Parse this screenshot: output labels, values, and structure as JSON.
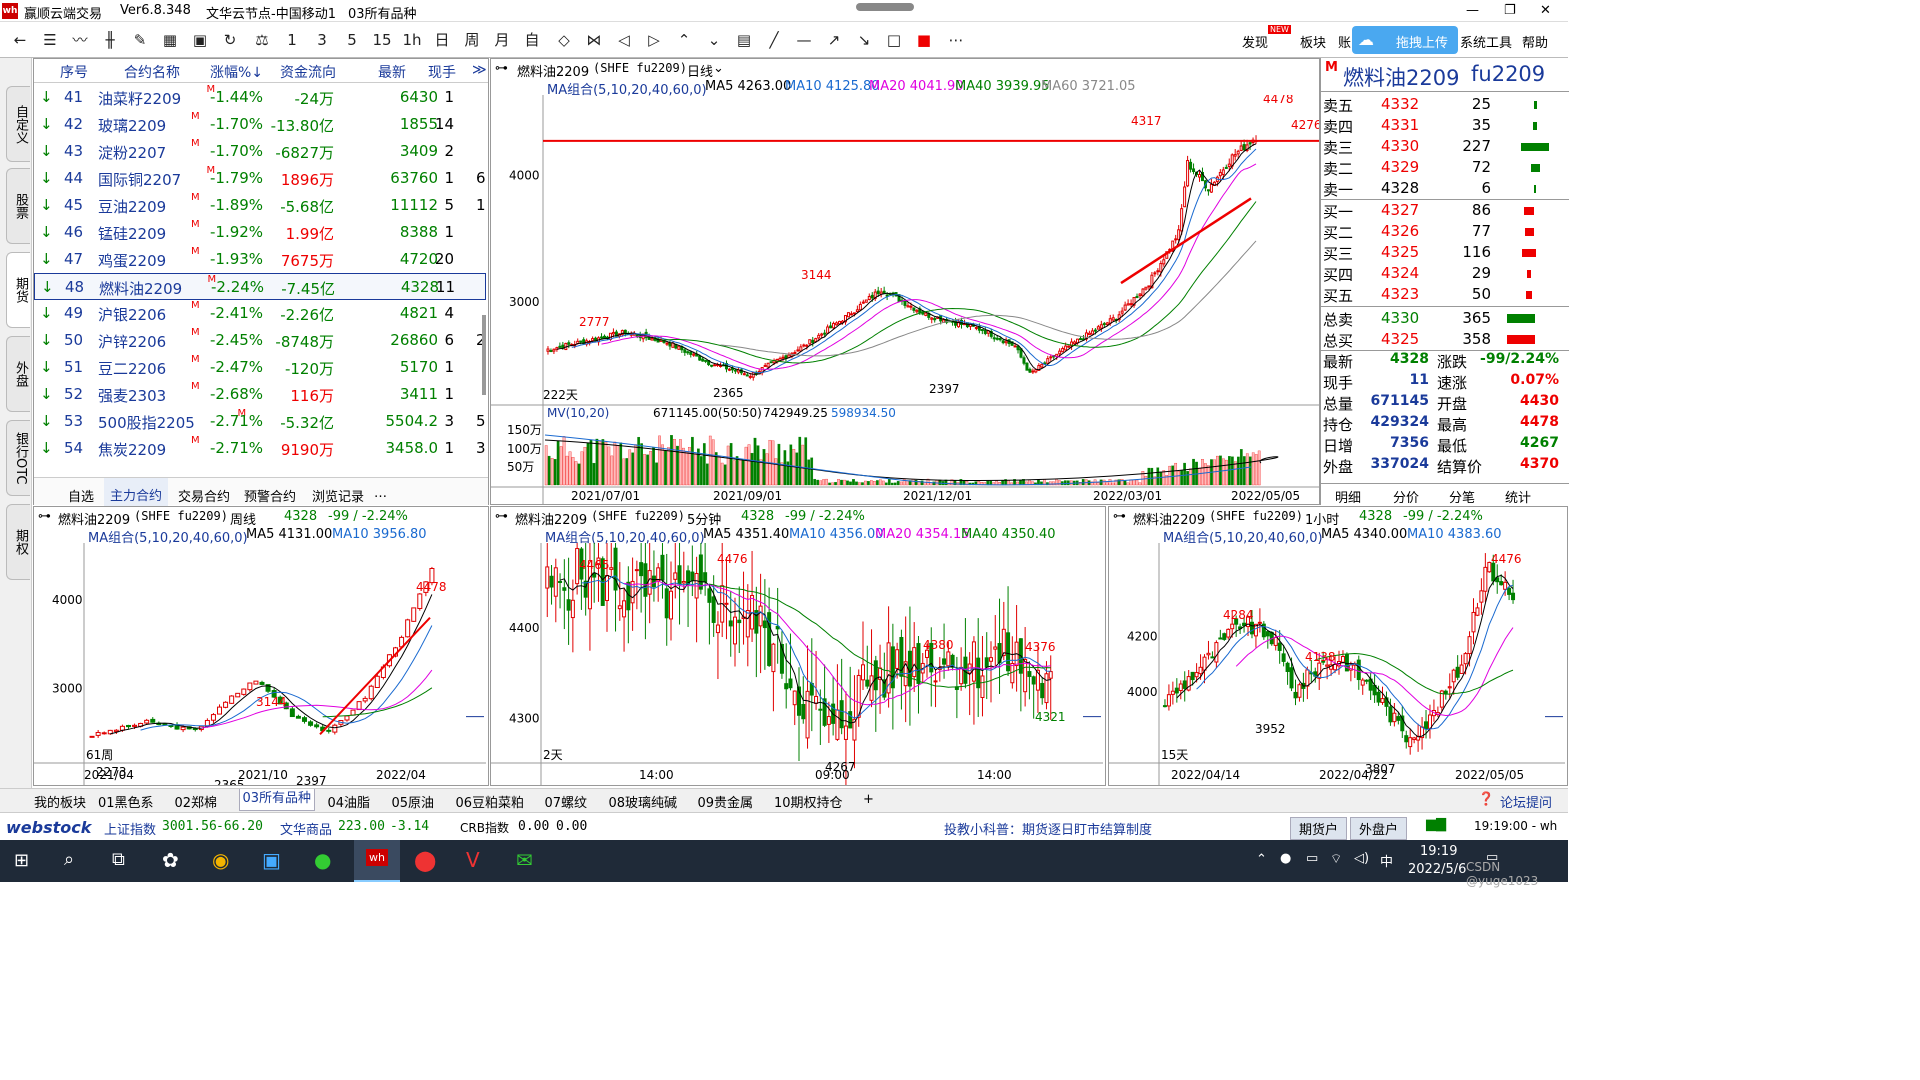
{
  "window": {
    "app": "赢顺云端交易",
    "version": "Ver6.8.348",
    "node": "文华云节点-中国移动1",
    "view": "03所有品种"
  },
  "toolbar": {
    "buttons": [
      "1",
      "3",
      "5",
      "15",
      "1h",
      "日",
      "周",
      "月",
      "自"
    ],
    "menus": [
      "发现",
      "板块",
      "账",
      "拖拽上传",
      "系统工具",
      "帮助"
    ],
    "new_badge": "NEW"
  },
  "lefttabs": [
    "自定义",
    "股票",
    "期货",
    "外盘",
    "银行OTC",
    "期权"
  ],
  "list": {
    "headers": [
      "序号",
      "合约名称",
      "涨幅%↓",
      "资金流向",
      "最新",
      "现手"
    ],
    "rows": [
      {
        "no": "41",
        "name": "油菜籽2209",
        "chg": "-1.44%",
        "flow": "-24万",
        "last": "6430",
        "vol": "1"
      },
      {
        "no": "42",
        "name": "玻璃2209",
        "chg": "-1.70%",
        "flow": "-13.80亿",
        "last": "1855",
        "vol": "14"
      },
      {
        "no": "43",
        "name": "淀粉2207",
        "chg": "-1.70%",
        "flow": "-6827万",
        "last": "3409",
        "vol": "2"
      },
      {
        "no": "44",
        "name": "国际铜2207",
        "chg": "-1.79%",
        "flow": "1896万",
        "last": "63760",
        "vol": "1",
        "extra": "6"
      },
      {
        "no": "45",
        "name": "豆油2209",
        "chg": "-1.89%",
        "flow": "-5.68亿",
        "last": "11112",
        "vol": "5",
        "extra": "1"
      },
      {
        "no": "46",
        "name": "锰硅2209",
        "chg": "-1.92%",
        "flow": "1.99亿",
        "last": "8388",
        "vol": "1"
      },
      {
        "no": "47",
        "name": "鸡蛋2209",
        "chg": "-1.93%",
        "flow": "7675万",
        "last": "4720",
        "vol": "20"
      },
      {
        "no": "48",
        "name": "燃料油2209",
        "chg": "-2.24%",
        "flow": "-7.45亿",
        "last": "4328",
        "vol": "11"
      },
      {
        "no": "49",
        "name": "沪银2206",
        "chg": "-2.41%",
        "flow": "-2.26亿",
        "last": "4821",
        "vol": "4"
      },
      {
        "no": "50",
        "name": "沪锌2206",
        "chg": "-2.45%",
        "flow": "-8748万",
        "last": "26860",
        "vol": "6",
        "extra": "2"
      },
      {
        "no": "51",
        "name": "豆二2206",
        "chg": "-2.47%",
        "flow": "-120万",
        "last": "5170",
        "vol": "1"
      },
      {
        "no": "52",
        "name": "强麦2303",
        "chg": "-2.68%",
        "flow": "116万",
        "last": "3411",
        "vol": "1"
      },
      {
        "no": "53",
        "name": "500股指2205",
        "chg": "-2.71%",
        "flow": "-5.32亿",
        "last": "5504.2",
        "vol": "3",
        "extra": "5"
      },
      {
        "no": "54",
        "name": "焦炭2209",
        "chg": "-2.71%",
        "flow": "9190万",
        "last": "3458.0",
        "vol": "1",
        "extra": "3"
      }
    ],
    "sup": "M",
    "tabs": [
      "自选",
      "主力合约",
      "交易合约",
      "预警合约",
      "浏览记录",
      "…"
    ]
  },
  "main_chart": {
    "title": "燃料油2209",
    "code": "(SHFE fu2209)",
    "period": "日线",
    "ma_label": "MA组合(5,10,20,40,60,0)",
    "ma": [
      "MA5 4263.00",
      "MA10 4125.80",
      "MA20 4041.90",
      "MA40 3939.95",
      "MA60 3721.05"
    ],
    "yticks": [
      "4000",
      "3000"
    ],
    "annots": [
      "4478",
      "4317",
      "3144",
      "2777",
      "2365",
      "2397",
      "4276"
    ],
    "days": "222天",
    "mv_label": "MV(10,20)",
    "mv_values": [
      "671145.00(50:50)",
      "742949.25",
      "598934.50"
    ],
    "mv_ticks": [
      "150万",
      "100万",
      "50万"
    ],
    "xticks": [
      "2021/07/01",
      "2021/09/01",
      "2021/12/01",
      "2022/03/01",
      "2022/05/05"
    ]
  },
  "quote": {
    "title": "燃料油2209",
    "code": "fu2209",
    "badge": "M",
    "asks": [
      {
        "l": "卖五",
        "p": "4332",
        "v": "25"
      },
      {
        "l": "卖四",
        "p": "4331",
        "v": "35"
      },
      {
        "l": "卖三",
        "p": "4330",
        "v": "227"
      },
      {
        "l": "卖二",
        "p": "4329",
        "v": "72"
      },
      {
        "l": "卖一",
        "p": "4328",
        "v": "6"
      }
    ],
    "bids": [
      {
        "l": "买一",
        "p": "4327",
        "v": "86"
      },
      {
        "l": "买二",
        "p": "4326",
        "v": "77"
      },
      {
        "l": "买三",
        "p": "4325",
        "v": "116"
      },
      {
        "l": "买四",
        "p": "4324",
        "v": "29"
      },
      {
        "l": "买五",
        "p": "4323",
        "v": "50"
      }
    ],
    "total_sell": {
      "l": "总卖",
      "p": "4330",
      "v": "365"
    },
    "total_buy": {
      "l": "总买",
      "p": "4325",
      "v": "358"
    },
    "stats": [
      {
        "l1": "最新",
        "v1": "4328",
        "l2": "涨跌",
        "v2": "-99/2.24%"
      },
      {
        "l1": "现手",
        "v1": "11",
        "l2": "速涨",
        "v2": "0.07%"
      },
      {
        "l1": "总量",
        "v1": "671145",
        "l2": "开盘",
        "v2": "4430"
      },
      {
        "l1": "持仓",
        "v1": "429324",
        "l2": "最高",
        "v2": "4478"
      },
      {
        "l1": "日增",
        "v1": "7356",
        "l2": "最低",
        "v2": "4267"
      },
      {
        "l1": "外盘",
        "v1": "337024",
        "l2": "结算价",
        "v2": "4370"
      }
    ],
    "tabs": [
      "明细",
      "分价",
      "分笔",
      "统计"
    ]
  },
  "sub_charts": [
    {
      "title": "燃料油2209",
      "code": "(SHFE fu2209)",
      "period": "周线",
      "last": "4328",
      "chg": "-99 / -2.24%",
      "ma_label": "MA组合(5,10,20,40,60,0)",
      "ma": [
        "MA5 4131.00",
        "MA10 3956.80"
      ],
      "yticks": [
        "4000",
        "3000"
      ],
      "annots": [
        "4478",
        "3144",
        "2365",
        "2397",
        "2273"
      ],
      "days": "61周",
      "xticks": [
        "2021/04",
        "2021/10",
        "2022/04"
      ]
    },
    {
      "title": "燃料油2209",
      "code": "(SHFE fu2209)",
      "period": "5分钟",
      "last": "4328",
      "chg": "-99 / -2.24%",
      "ma_label": "MA组合(5,10,20,40,60,0)",
      "ma": [
        "MA5 4351.40",
        "MA10 4356.00",
        "MA20 4354.15",
        "MA40 4350.40"
      ],
      "yticks": [
        "4400",
        "4300"
      ],
      "annots": [
        "4465",
        "4476",
        "4380",
        "4376",
        "4267",
        "4321"
      ],
      "days": "2天",
      "xticks": [
        "14:00",
        "09:00",
        "14:00"
      ]
    },
    {
      "title": "燃料油2209",
      "code": "(SHFE fu2209)",
      "period": "1小时",
      "last": "4328",
      "chg": "-99 / -2.24%",
      "ma_label": "MA组合(5,10,20,40,60,0)",
      "ma": [
        "MA5 4340.00",
        "MA10 4383.60"
      ],
      "yticks": [
        "4200",
        "4000"
      ],
      "annots": [
        "4476",
        "4284",
        "4138",
        "3952",
        "3807"
      ],
      "days": "15天",
      "xticks": [
        "2022/04/14",
        "2022/04/22",
        "2022/05/05"
      ]
    }
  ],
  "categories": [
    "我的板块",
    "01黑色系",
    "02郑棉",
    "03所有品种",
    "04油脂",
    "05原油",
    "06豆粕菜粕",
    "07螺纹",
    "08玻璃纯碱",
    "09贵金属",
    "10期权持仓",
    "+"
  ],
  "forum": "论坛提问",
  "status": {
    "logo": "webstock",
    "sh_label": "上证指数",
    "sh_val": "3001.56",
    "sh_chg": "-66.20",
    "wh_label": "文华商品",
    "wh_val": "223.00",
    "wh_chg": "-3.14",
    "crb_label": "CRB指数",
    "crb_val": "0.00",
    "crb_chg": "0.00",
    "tip": "投教小科普：期货逐日盯市结算制度",
    "btn1": "期货户",
    "btn2": "外盘户",
    "clock": "19:19:00 - wh"
  },
  "taskbar": {
    "time": "19:19",
    "date": "2022/5/6",
    "ime": "中",
    "watermark": "CSDN @yuge1023"
  },
  "colors": {
    "up": "#e00000",
    "down": "#008000",
    "accent": "#1a3a9a"
  }
}
